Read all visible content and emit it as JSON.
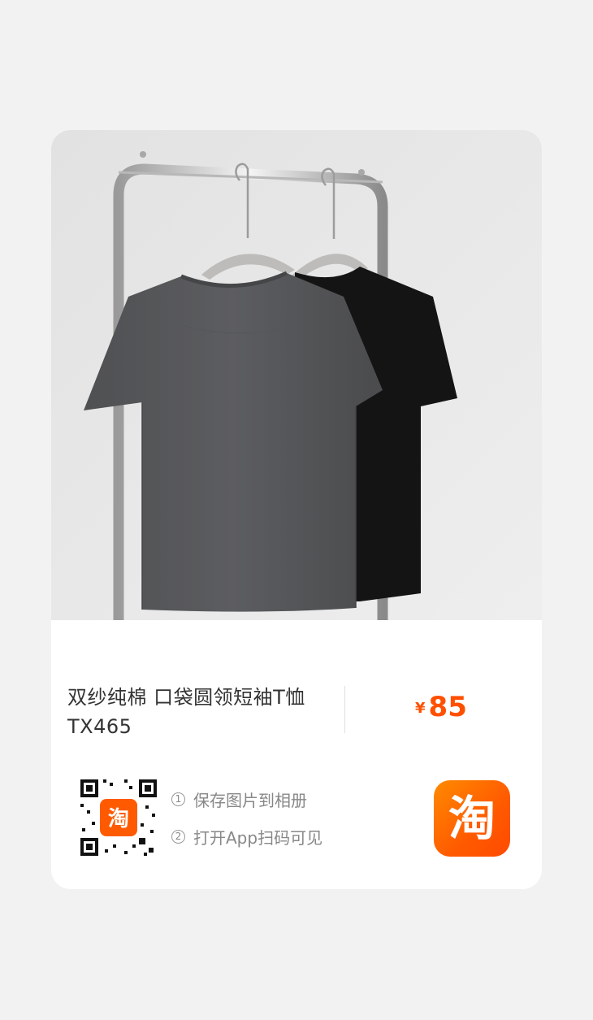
{
  "product": {
    "title_line1": "双纱纯棉 口袋圆领短袖T恤",
    "title_line2": "TX465",
    "price_currency": "¥",
    "price_amount": "85"
  },
  "share": {
    "steps": [
      {
        "number": "1",
        "label": "保存图片到相册"
      },
      {
        "number": "2",
        "label": "打开App扫码可见"
      }
    ],
    "qr_center_badge_text": "淘"
  },
  "brand": {
    "logo_text": "淘",
    "accent_color": "#ff5000"
  },
  "icons": {
    "product_photo": "tshirt-photo",
    "qr": "qr-code-icon",
    "app_logo": "taobao-logo-icon"
  }
}
